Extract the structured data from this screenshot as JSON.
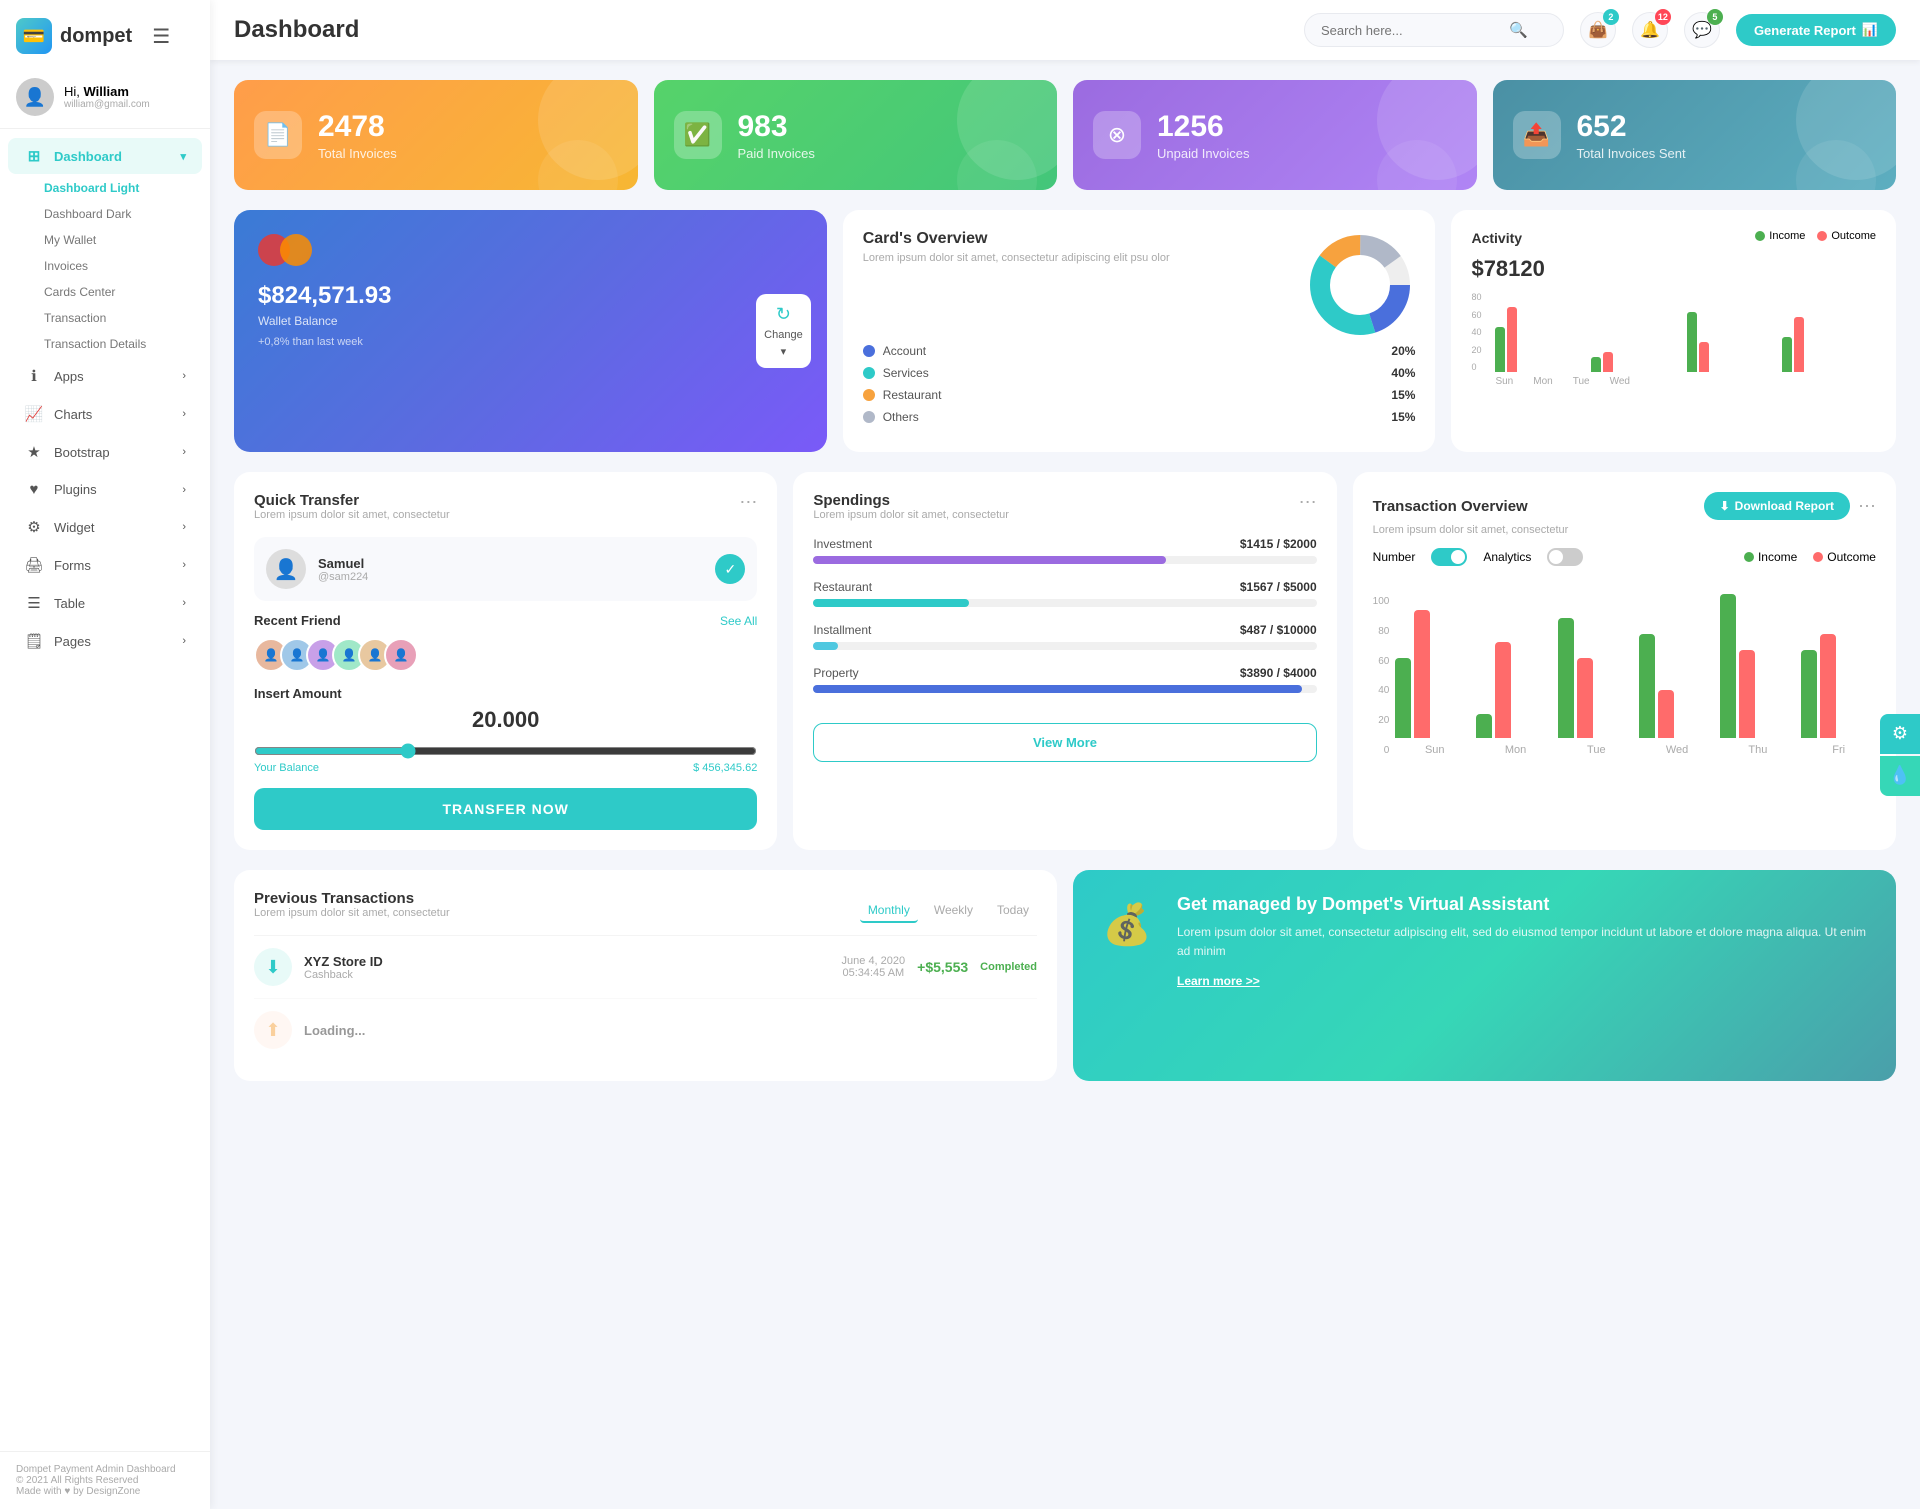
{
  "app": {
    "name": "dompet",
    "title": "Dashboard"
  },
  "header": {
    "search_placeholder": "Search here...",
    "search_icon": "🔍",
    "generate_btn": "Generate Report",
    "notification_count_wallet": "2",
    "notification_count_bell": "12",
    "notification_count_msg": "5"
  },
  "user": {
    "greeting": "Hi,",
    "name": "William",
    "email": "william@gmail.com"
  },
  "sidebar": {
    "nav_items": [
      {
        "id": "dashboard",
        "label": "Dashboard",
        "icon": "⊞",
        "has_arrow": true,
        "active": true
      },
      {
        "id": "apps",
        "label": "Apps",
        "icon": "ℹ",
        "has_arrow": true
      },
      {
        "id": "charts",
        "label": "Charts",
        "icon": "📈",
        "has_arrow": true
      },
      {
        "id": "bootstrap",
        "label": "Bootstrap",
        "icon": "★",
        "has_arrow": true
      },
      {
        "id": "plugins",
        "label": "Plugins",
        "icon": "♥",
        "has_arrow": true
      },
      {
        "id": "widget",
        "label": "Widget",
        "icon": "⚙",
        "has_arrow": true
      },
      {
        "id": "forms",
        "label": "Forms",
        "icon": "📋",
        "has_arrow": true
      },
      {
        "id": "table",
        "label": "Table",
        "icon": "☰",
        "has_arrow": true
      },
      {
        "id": "pages",
        "label": "Pages",
        "icon": "🗒",
        "has_arrow": true
      }
    ],
    "sub_items": [
      {
        "label": "Dashboard Light",
        "active": true
      },
      {
        "label": "Dashboard Dark"
      },
      {
        "label": "My Wallet"
      },
      {
        "label": "Invoices"
      },
      {
        "label": "Cards Center"
      },
      {
        "label": "Transaction"
      },
      {
        "label": "Transaction Details"
      }
    ],
    "footer_line1": "Dompet Payment Admin Dashboard",
    "footer_line2": "© 2021 All Rights Reserved",
    "footer_line3": "Made with ♥ by DesignZone"
  },
  "stat_cards": [
    {
      "id": "total-invoices",
      "number": "2478",
      "label": "Total Invoices",
      "icon": "📄",
      "color": "orange"
    },
    {
      "id": "paid-invoices",
      "number": "983",
      "label": "Paid Invoices",
      "icon": "✅",
      "color": "green"
    },
    {
      "id": "unpaid-invoices",
      "number": "1256",
      "label": "Unpaid Invoices",
      "icon": "⊗",
      "color": "purple"
    },
    {
      "id": "total-sent",
      "number": "652",
      "label": "Total Invoices Sent",
      "icon": "📤",
      "color": "teal"
    }
  ],
  "wallet": {
    "card_circles": [
      "red",
      "orange"
    ],
    "balance": "$824,571.93",
    "balance_label": "Wallet Balance",
    "change": "+0,8% than last week",
    "change_btn_label": "Change"
  },
  "card_overview": {
    "title": "Card's Overview",
    "subtitle": "Lorem ipsum dolor sit amet, consectetur adipiscing elit psu olor",
    "segments": [
      {
        "label": "Account",
        "percent": "20%",
        "color": "#4a6fdc"
      },
      {
        "label": "Services",
        "percent": "40%",
        "color": "#2ecac8"
      },
      {
        "label": "Restaurant",
        "percent": "15%",
        "color": "#f7a23e"
      },
      {
        "label": "Others",
        "percent": "15%",
        "color": "#b0b8c8"
      }
    ]
  },
  "activity": {
    "title": "Activity",
    "amount": "$78120",
    "legend": [
      {
        "label": "Income",
        "color": "#4caf50"
      },
      {
        "label": "Outcome",
        "color": "#ff6b6b"
      }
    ],
    "bars": [
      {
        "day": "Sun",
        "income": 45,
        "outcome": 65
      },
      {
        "day": "Mon",
        "income": 15,
        "outcome": 20
      },
      {
        "day": "Tue",
        "income": 60,
        "outcome": 30
      },
      {
        "day": "Wed",
        "income": 35,
        "outcome": 55
      }
    ],
    "y_labels": [
      "80",
      "60",
      "40",
      "20",
      "0"
    ]
  },
  "quick_transfer": {
    "title": "Quick Transfer",
    "subtitle": "Lorem ipsum dolor sit amet, consectetur",
    "contact": {
      "name": "Samuel",
      "handle": "@sam224",
      "avatar_emoji": "👤"
    },
    "recent_friend_label": "Recent Friend",
    "see_all_label": "See All",
    "insert_amount_label": "Insert Amount",
    "amount": "20.000",
    "balance_label": "Your Balance",
    "balance": "$ 456,345.62",
    "transfer_btn": "TRANSFER NOW"
  },
  "spendings": {
    "title": "Spendings",
    "subtitle": "Lorem ipsum dolor sit amet, consectetur",
    "items": [
      {
        "label": "Investment",
        "current": "$1415",
        "total": "$2000",
        "percent": 70,
        "color": "#9b6be0"
      },
      {
        "label": "Restaurant",
        "current": "$1567",
        "total": "$5000",
        "percent": 31,
        "color": "#2ecac8"
      },
      {
        "label": "Installment",
        "current": "$487",
        "total": "$10000",
        "percent": 5,
        "color": "#4fc8e0"
      },
      {
        "label": "Property",
        "current": "$3890",
        "total": "$4000",
        "percent": 97,
        "color": "#4a6fdc"
      }
    ],
    "view_more_btn": "View More"
  },
  "transaction_overview": {
    "title": "Transaction Overview",
    "subtitle": "Lorem ipsum dolor sit amet, consectetur",
    "download_btn": "Download Report",
    "toggle1_label": "Number",
    "toggle2_label": "Analytics",
    "legend": [
      {
        "label": "Income",
        "color": "#4caf50"
      },
      {
        "label": "Outcome",
        "color": "#ff6b6b"
      }
    ],
    "bars": [
      {
        "day": "Sun",
        "income": 50,
        "outcome": 80
      },
      {
        "day": "Mon",
        "income": 15,
        "outcome": 60
      },
      {
        "day": "Tue",
        "income": 75,
        "outcome": 50
      },
      {
        "day": "Wed",
        "income": 65,
        "outcome": 30
      },
      {
        "day": "Thu",
        "income": 90,
        "outcome": 55
      },
      {
        "day": "Fri",
        "income": 55,
        "outcome": 65
      }
    ],
    "y_labels": [
      "100",
      "80",
      "60",
      "40",
      "20",
      "0"
    ]
  },
  "previous_transactions": {
    "title": "Previous Transactions",
    "subtitle": "Lorem ipsum dolor sit amet, consectetur",
    "period_tabs": [
      "Monthly",
      "Weekly",
      "Today"
    ],
    "active_tab": "Monthly",
    "rows": [
      {
        "name": "XYZ Store ID",
        "type": "Cashback",
        "date": "June 4, 2020",
        "time": "05:34:45 AM",
        "amount": "+$5,553",
        "status": "Completed",
        "icon": "⬇"
      }
    ]
  },
  "virtual_assistant": {
    "title": "Get managed by Dompet's Virtual Assistant",
    "desc": "Lorem ipsum dolor sit amet, consectetur adipiscing elit, sed do eiusmod tempor incidunt ut labore et dolore magna aliqua. Ut enim ad minim",
    "link": "Learn more >>"
  },
  "colors": {
    "primary": "#2ecac8",
    "orange": "#f7a23e",
    "green": "#43c67a",
    "purple": "#9b6be0",
    "teal": "#5daec0",
    "danger": "#ff6b6b",
    "success": "#4caf50"
  }
}
